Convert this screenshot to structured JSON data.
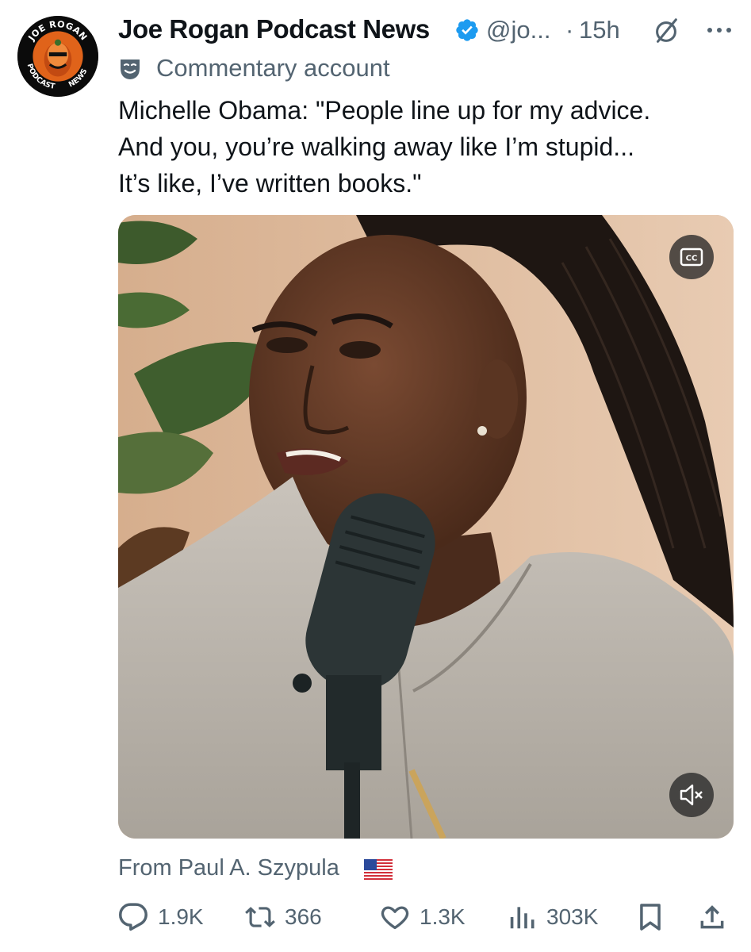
{
  "tweet": {
    "author": {
      "display_name": "Joe Rogan Podcast News",
      "handle": "@jo...",
      "separator": "·",
      "time": "15h",
      "avatar_text_top": "JOE ROGAN",
      "avatar_text_left": "PODCAST",
      "avatar_text_right": "NEWS"
    },
    "label": "Commentary account",
    "text_lines": [
      "Michelle Obama: \"People line up for my advice.",
      "And you, you’re walking away like I’m stupid...",
      "It’s like, I’ve written books.\""
    ],
    "media": {
      "cc_label": "CC"
    },
    "source": "From Paul A. Szypula",
    "actions": {
      "replies": "1.9K",
      "reposts": "366",
      "likes": "1.3K",
      "views": "303K"
    },
    "colors": {
      "text": "#0f1419",
      "secondary": "#536471",
      "verified": "#1d9bf0"
    },
    "icons": [
      "verified-badge-icon",
      "grok-icon",
      "more-icon",
      "mask-icon",
      "cc-icon",
      "mute-icon",
      "flag-icon",
      "reply-icon",
      "repost-icon",
      "like-icon",
      "views-icon",
      "bookmark-icon",
      "share-icon"
    ]
  }
}
